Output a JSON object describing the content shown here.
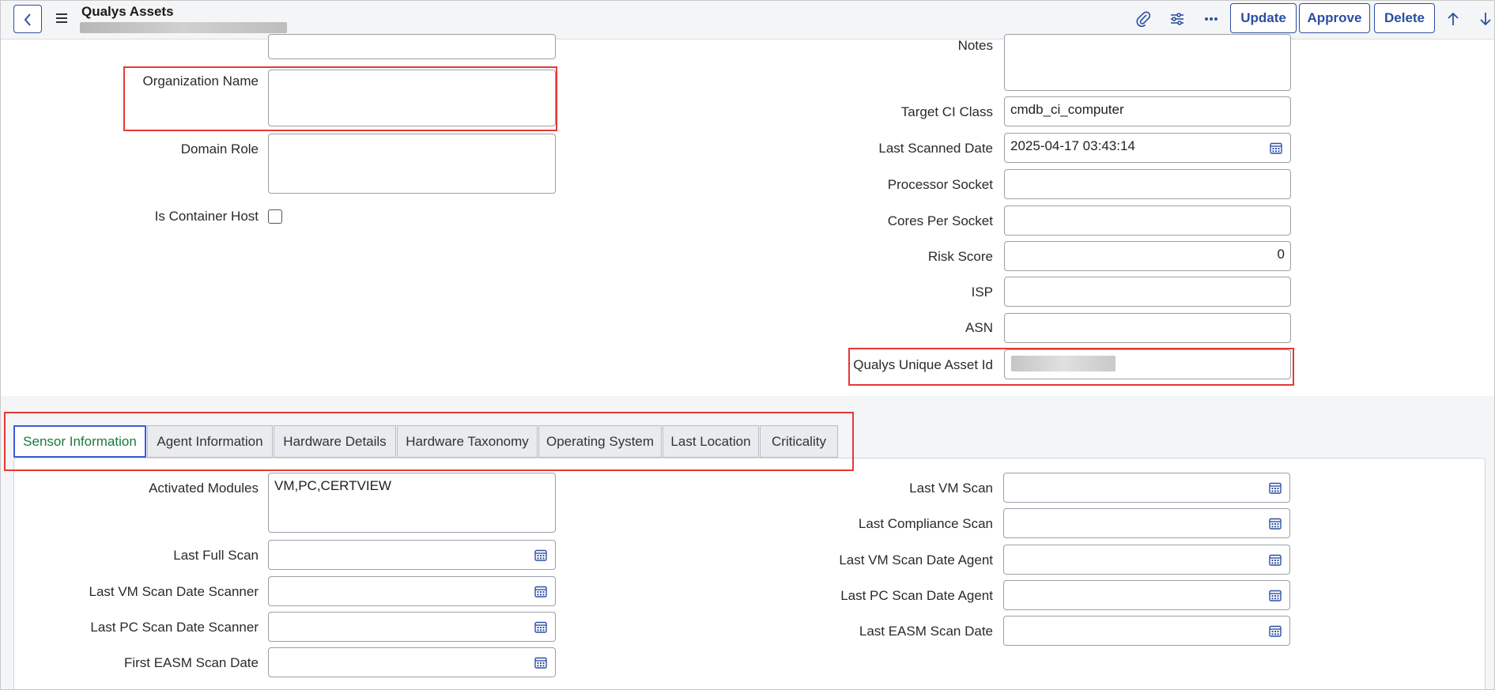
{
  "header": {
    "title": "Qualys Assets",
    "buttons": {
      "update": "Update",
      "approve": "Approve",
      "delete": "Delete"
    }
  },
  "form": {
    "organization_name": {
      "label": "Organization Name",
      "value": ""
    },
    "domain_role": {
      "label": "Domain Role",
      "value": ""
    },
    "is_container_host": {
      "label": "Is Container Host",
      "checked": false
    },
    "notes": {
      "label": "Notes",
      "value": ""
    },
    "target_ci_class": {
      "label": "Target CI Class",
      "value": "cmdb_ci_computer"
    },
    "last_scanned_date": {
      "label": "Last Scanned Date",
      "value": "2025-04-17 03:43:14"
    },
    "processor_socket": {
      "label": "Processor Socket",
      "value": ""
    },
    "cores_per_socket": {
      "label": "Cores Per Socket",
      "value": ""
    },
    "risk_score": {
      "label": "Risk Score",
      "value": "0"
    },
    "isp": {
      "label": "ISP",
      "value": ""
    },
    "asn": {
      "label": "ASN",
      "value": ""
    },
    "qualys_unique_asset_id": {
      "label": "Qualys Unique Asset Id",
      "value": ""
    }
  },
  "tabs": [
    {
      "label": "Sensor Information",
      "active": true
    },
    {
      "label": "Agent Information",
      "active": false
    },
    {
      "label": "Hardware Details",
      "active": false
    },
    {
      "label": "Hardware Taxonomy",
      "active": false
    },
    {
      "label": "Operating System",
      "active": false
    },
    {
      "label": "Last Location",
      "active": false
    },
    {
      "label": "Criticality",
      "active": false
    }
  ],
  "sensor": {
    "activated_modules": {
      "label": "Activated Modules",
      "value": "VM,PC,CERTVIEW"
    },
    "last_full_scan": {
      "label": "Last Full Scan",
      "value": ""
    },
    "last_vm_scan_date_scanner": {
      "label": "Last VM Scan Date Scanner",
      "value": ""
    },
    "last_pc_scan_date_scanner": {
      "label": "Last PC Scan Date Scanner",
      "value": ""
    },
    "first_easm_scan_date": {
      "label": "First EASM Scan Date",
      "value": ""
    },
    "last_vm_scan": {
      "label": "Last VM Scan",
      "value": ""
    },
    "last_compliance_scan": {
      "label": "Last Compliance Scan",
      "value": ""
    },
    "last_vm_scan_date_agent": {
      "label": "Last VM Scan Date Agent",
      "value": ""
    },
    "last_pc_scan_date_agent": {
      "label": "Last PC Scan Date Agent",
      "value": ""
    },
    "last_easm_scan_date": {
      "label": "Last EASM Scan Date",
      "value": ""
    }
  },
  "icons": [
    "chevron-left-icon",
    "menu-icon",
    "paperclip-icon",
    "settings-sliders-icon",
    "more-icon",
    "arrow-up-icon",
    "arrow-down-icon",
    "calendar-icon"
  ],
  "colors": {
    "accent": "#2e4fa3",
    "highlight": "#e53935",
    "active_tab_text": "#1b7a3d"
  }
}
